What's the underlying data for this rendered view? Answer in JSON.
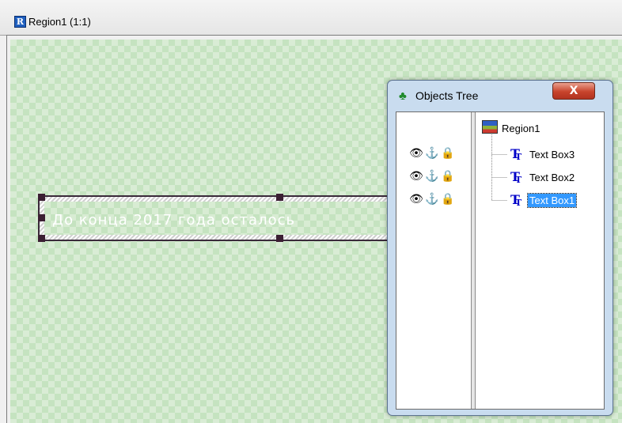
{
  "window": {
    "title": "Region1  (1:1)",
    "app_icon": "R"
  },
  "canvas": {
    "textbox_text": "До конца 2017 года осталось"
  },
  "objects_tree": {
    "title": "Objects Tree",
    "close_label": "X",
    "root": "Region1",
    "nodes": [
      {
        "label": "Text Box3",
        "selected": false
      },
      {
        "label": "Text Box2",
        "selected": false
      },
      {
        "label": "Text Box1",
        "selected": true
      }
    ],
    "status_icons": [
      "eye-icon",
      "anchor-icon",
      "lock-icon"
    ]
  },
  "colors": {
    "canvas_check_light": "#d9ecd5",
    "canvas_check_dark": "#c5e3c0",
    "selection": "#3399ff",
    "text_icon": "#0000c8"
  }
}
